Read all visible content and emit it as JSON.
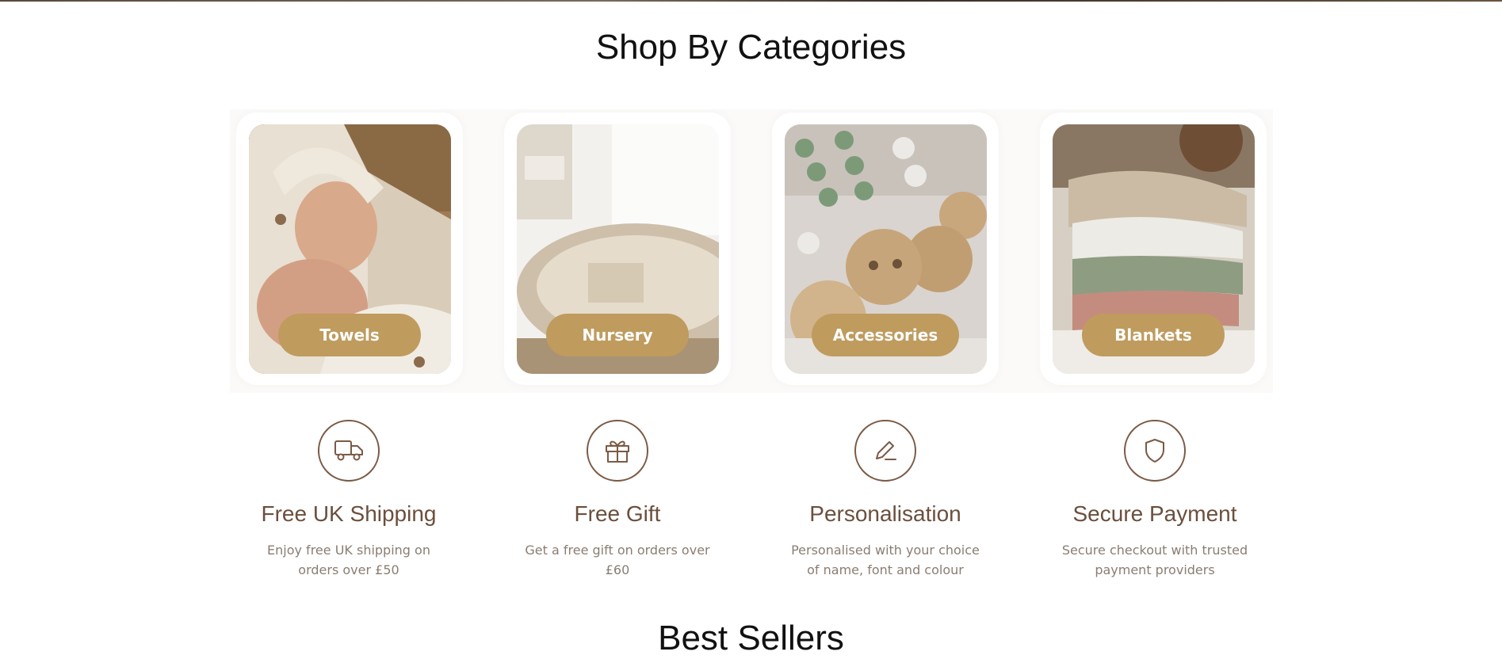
{
  "section": {
    "title": "Shop By Categories"
  },
  "categories": [
    {
      "label": "Towels",
      "image": "baby-in-hooded-towel"
    },
    {
      "label": "Nursery",
      "image": "woven-changing-basket"
    },
    {
      "label": "Accessories",
      "image": "wooden-pacifier-clips"
    },
    {
      "label": "Blankets",
      "image": "folded-knit-blankets"
    }
  ],
  "features": [
    {
      "icon": "truck-icon",
      "title": "Free UK Shipping",
      "desc": "Enjoy free UK shipping on orders over £50"
    },
    {
      "icon": "gift-icon",
      "title": "Free Gift",
      "desc": "Get a free gift on orders over £60"
    },
    {
      "icon": "pencil-icon",
      "title": "Personalisation",
      "desc": "Personalised with your choice of name, font and colour"
    },
    {
      "icon": "shield-icon",
      "title": "Secure Payment",
      "desc": "Secure checkout with trusted payment providers"
    }
  ],
  "next_section": {
    "title": "Best Sellers"
  },
  "colors": {
    "accent": "#bf9b5e",
    "feature_text": "#6b4f3d",
    "muted": "#8a7d72"
  }
}
